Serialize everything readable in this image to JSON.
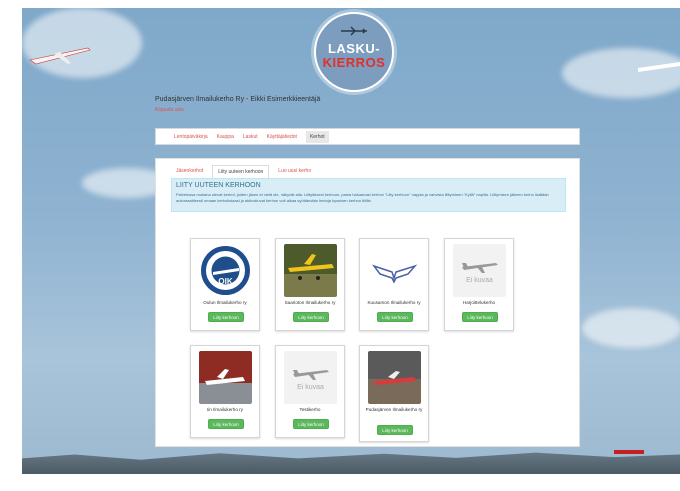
{
  "logo": {
    "line1": "LASKU-",
    "line2": "KIERROS"
  },
  "header": {
    "title": "Pudasjärven Ilmailukerho Ry - Eikki Esimerkkieentäjä",
    "subtitle": "Kirjaudu ulos"
  },
  "nav": {
    "items": [
      {
        "label": "Lentopäiväkirja"
      },
      {
        "label": "Kauppa"
      },
      {
        "label": "Laskut"
      },
      {
        "label": "Käyttäjätiedot"
      },
      {
        "label": "Kerhot"
      }
    ]
  },
  "tabs": [
    {
      "label": "Jäsenkerhot"
    },
    {
      "label": "Liity uuteen kerhoon"
    },
    {
      "label": "Luo uusi kerho"
    }
  ],
  "alert": {
    "heading": "LIITY UUTEEN KERHOON",
    "text": "Palvelussa mukana olevat kerhot, joiden jäsen et vielä ole, näkyvät alla. Liittyäksesi kerhoon, paina haluamasi kerhon \"Liity kerhoon\" nappia ja vahvista liittyminen \"Kyllä\" napilla. Liittymisen jälkeen kerho lisätään automaattisesti omaan kerholistaasi ja aktivoituvat kerhon voit alkaa syöttämään lentoja kyseisen kerhon tiliille."
  },
  "no_image_text": "Ei kuvaa",
  "join_label": "Liity kerhoon",
  "clubs": [
    {
      "name": "Oulun Ilmailukerho ry"
    },
    {
      "name": "Saarioton Ilmailukerho ry"
    },
    {
      "name": "Kuusamon Ilmailukerho ry"
    },
    {
      "name": "Harjoittelukerho"
    },
    {
      "name": "Iin Ilmailukerho ry"
    },
    {
      "name": "Testikerho"
    },
    {
      "name": "Pudasjärven Ilmailukerho ry"
    }
  ],
  "colors": {
    "accent": "#d9534f",
    "button": "#5cb85c",
    "alert_bg": "#d9edf7",
    "sky": "#8fb3d1"
  }
}
